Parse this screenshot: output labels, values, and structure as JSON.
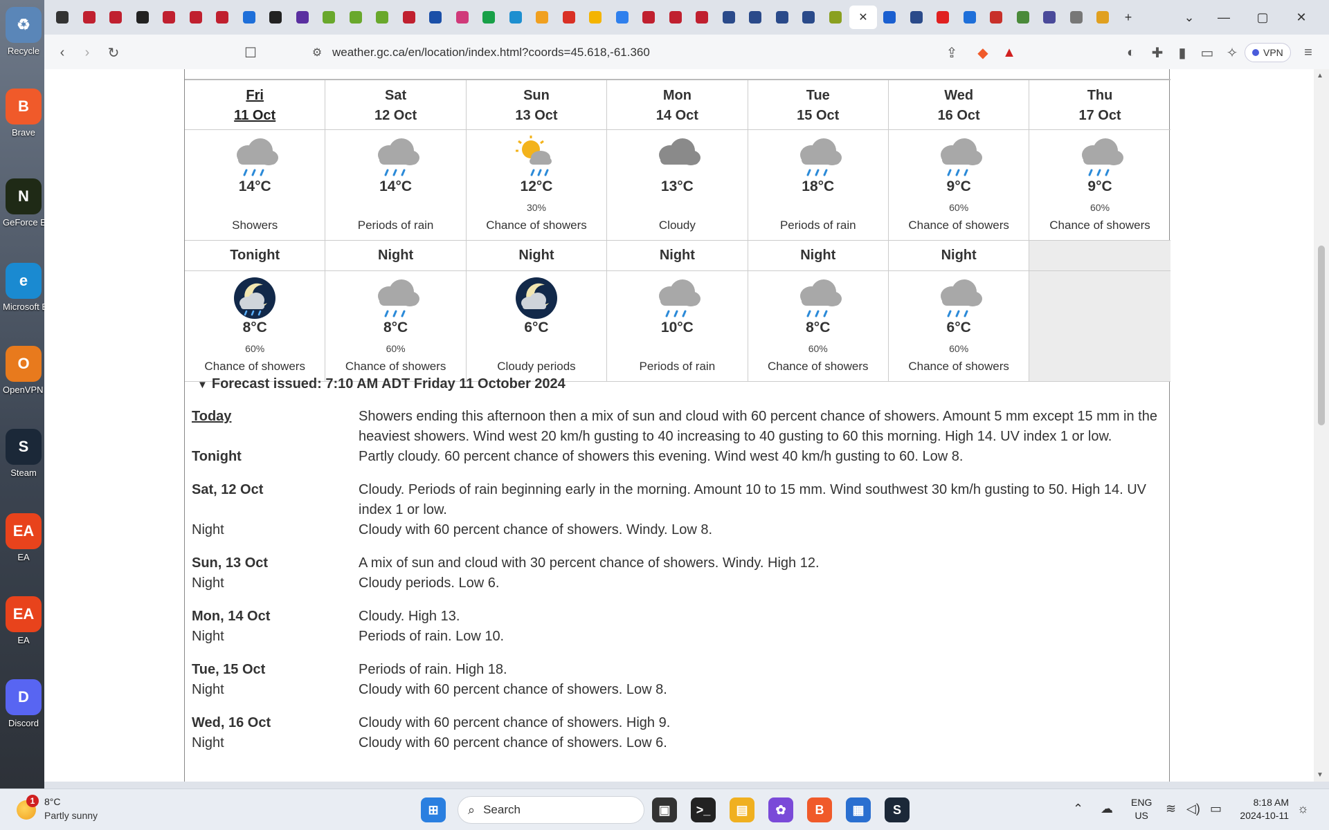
{
  "desktop": {
    "icons": [
      {
        "label": "Recycle",
        "glyph": "♻",
        "color": "#5a86b8"
      },
      {
        "label": "Brave",
        "glyph": "B",
        "color": "#f05a2a"
      },
      {
        "label": "GeForce Experience",
        "glyph": "N",
        "color": "#1f2a16"
      },
      {
        "label": "Microsoft Edge",
        "glyph": "e",
        "color": "#1a8ad1"
      },
      {
        "label": "OpenVPN GUI",
        "glyph": "O",
        "color": "#e87a1d"
      },
      {
        "label": "Steam",
        "glyph": "S",
        "color": "#1b2838"
      },
      {
        "label": "EA",
        "glyph": "EA",
        "color": "#e8431c"
      },
      {
        "label": "EA",
        "glyph": "EA",
        "color": "#e8431c"
      },
      {
        "label": "Discord",
        "glyph": "D",
        "color": "#5865f2"
      }
    ]
  },
  "browser": {
    "url": "weather.gc.ca/en/location/index.html?coords=45.618,-61.360",
    "vpn_label": "VPN",
    "tab_colors": [
      "#333",
      "#c0202f",
      "#c0202f",
      "#222",
      "#c0202f",
      "#c0202f",
      "#c0202f",
      "#1e6fd9",
      "#222",
      "#5a2fa0",
      "#69a82c",
      "#69a82c",
      "#69a82c",
      "#c0202f",
      "#1a4fa8",
      "#d03a7a",
      "#18a048",
      "#1d8fd0",
      "#f0a020",
      "#d93025",
      "#f4b400",
      "#2f80ed",
      "#c0202f",
      "#c0202f",
      "#c0202f",
      "#2a4a8a",
      "#2a4a8a",
      "#2a4a8a",
      "#2a4a8a",
      "#8aa020",
      "#1a5fd0",
      "#2a4a8a",
      "#e02020",
      "#1e6fd9",
      "#c8302a",
      "#4a8a3a",
      "#4a4a9a",
      "#777",
      "#e0a020"
    ],
    "active_tab_close": "✕"
  },
  "forecast": {
    "days": [
      {
        "name": "Fri",
        "date": "11 Oct",
        "today": true,
        "icon": "rain-cloud-icon",
        "temp": "14°C",
        "pop": "",
        "cond": "Showers"
      },
      {
        "name": "Sat",
        "date": "12 Oct",
        "today": false,
        "icon": "rain-cloud-icon",
        "temp": "14°C",
        "pop": "",
        "cond": "Periods of rain"
      },
      {
        "name": "Sun",
        "date": "13 Oct",
        "today": false,
        "icon": "sun-cloud-rain-icon",
        "temp": "12°C",
        "pop": "30%",
        "cond": "Chance of showers"
      },
      {
        "name": "Mon",
        "date": "14 Oct",
        "today": false,
        "icon": "cloud-icon",
        "temp": "13°C",
        "pop": "",
        "cond": "Cloudy"
      },
      {
        "name": "Tue",
        "date": "15 Oct",
        "today": false,
        "icon": "rain-cloud-icon",
        "temp": "18°C",
        "pop": "",
        "cond": "Periods of rain"
      },
      {
        "name": "Wed",
        "date": "16 Oct",
        "today": false,
        "icon": "rain-cloud-icon",
        "temp": "9°C",
        "pop": "60%",
        "cond": "Chance of showers"
      },
      {
        "name": "Thu",
        "date": "17 Oct",
        "today": false,
        "icon": "rain-cloud-icon",
        "temp": "9°C",
        "pop": "60%",
        "cond": "Chance of showers"
      }
    ],
    "nights": [
      {
        "label": "Tonight",
        "icon": "night-rain-icon",
        "temp": "8°C",
        "pop": "60%",
        "cond": "Chance of showers"
      },
      {
        "label": "Night",
        "icon": "rain-cloud-icon",
        "temp": "8°C",
        "pop": "60%",
        "cond": "Chance of showers"
      },
      {
        "label": "Night",
        "icon": "night-cloud-icon",
        "temp": "6°C",
        "pop": "",
        "cond": "Cloudy periods"
      },
      {
        "label": "Night",
        "icon": "rain-cloud-icon",
        "temp": "10°C",
        "pop": "",
        "cond": "Periods of rain"
      },
      {
        "label": "Night",
        "icon": "rain-cloud-icon",
        "temp": "8°C",
        "pop": "60%",
        "cond": "Chance of showers"
      },
      {
        "label": "Night",
        "icon": "rain-cloud-icon",
        "temp": "6°C",
        "pop": "60%",
        "cond": "Chance of showers"
      }
    ],
    "issued": "Forecast issued: 7:10 AM ADT Friday 11 October 2024",
    "details": [
      {
        "name": "Today",
        "link": true,
        "plain": false,
        "text": "Showers ending this afternoon then a mix of sun and cloud with 60 percent chance of showers. Amount 5 mm except 15 mm in the heaviest showers. Wind west 20 km/h gusting to 40 increasing to 40 gusting to 60 this morning. High 14. UV index 1 or low."
      },
      {
        "name": "Tonight",
        "link": false,
        "plain": false,
        "text": "Partly cloudy. 60 percent chance of showers this evening. Wind west 40 km/h gusting to 60. Low 8.",
        "gap": true
      },
      {
        "name": "Sat, 12 Oct",
        "link": false,
        "plain": false,
        "text": "Cloudy. Periods of rain beginning early in the morning. Amount 10 to 15 mm. Wind southwest 30 km/h gusting to 50. High 14. UV index 1 or low."
      },
      {
        "name": "Night",
        "link": false,
        "plain": true,
        "text": "Cloudy with 60 percent chance of showers. Windy. Low 8.",
        "gap": true
      },
      {
        "name": "Sun, 13 Oct",
        "link": false,
        "plain": false,
        "text": "A mix of sun and cloud with 30 percent chance of showers. Windy. High 12."
      },
      {
        "name": "Night",
        "link": false,
        "plain": true,
        "text": "Cloudy periods. Low 6.",
        "gap": true
      },
      {
        "name": "Mon, 14 Oct",
        "link": false,
        "plain": false,
        "text": "Cloudy. High 13."
      },
      {
        "name": "Night",
        "link": false,
        "plain": true,
        "text": "Periods of rain. Low 10.",
        "gap": true
      },
      {
        "name": "Tue, 15 Oct",
        "link": false,
        "plain": false,
        "text": "Periods of rain. High 18."
      },
      {
        "name": "Night",
        "link": false,
        "plain": true,
        "text": "Cloudy with 60 percent chance of showers. Low 8.",
        "gap": true
      },
      {
        "name": "Wed, 16 Oct",
        "link": false,
        "plain": false,
        "text": "Cloudy with 60 percent chance of showers. High 9."
      },
      {
        "name": "Night",
        "link": false,
        "plain": true,
        "text": "Cloudy with 60 percent chance of showers. Low 6."
      }
    ]
  },
  "taskbar": {
    "weather_temp": "8°C",
    "weather_cond": "Partly sunny",
    "weather_badge": "1",
    "search_placeholder": "Search",
    "lang_top": "ENG",
    "lang_bottom": "US",
    "time": "8:18 AM",
    "date": "2024-10-11"
  }
}
